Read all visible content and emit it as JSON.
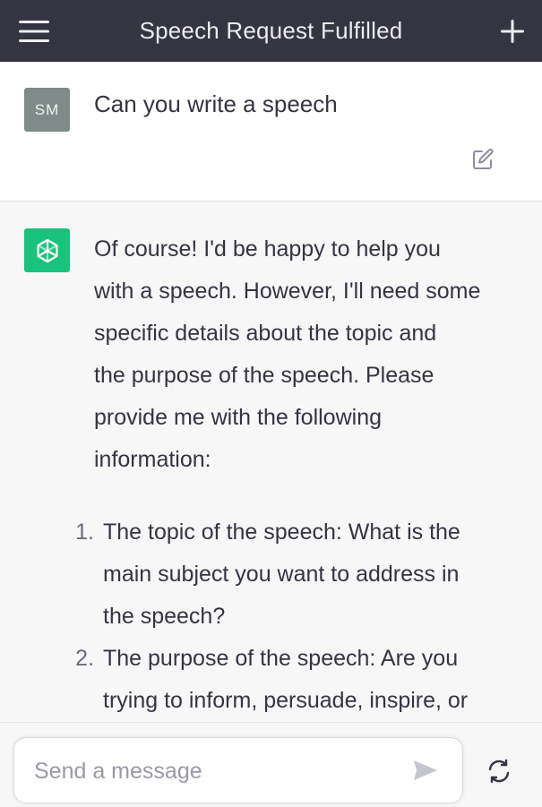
{
  "header": {
    "title": "Speech Request Fulfilled",
    "menu_icon": "hamburger-menu-icon",
    "new_chat_icon": "plus-icon"
  },
  "user_message": {
    "avatar_initials": "SM",
    "text": "Can you write a speech",
    "edit_icon": "edit-icon"
  },
  "assistant_message": {
    "avatar_icon": "openai-logo-icon",
    "intro_lines": [
      "Of course! I'd be happy to help you",
      "with a speech. However, I'll need some",
      "specific details about the topic and",
      "the purpose of the speech. Please",
      "provide me with the following",
      "information:"
    ],
    "list": [
      {
        "number": "1.",
        "lines": [
          "The topic of the speech: What is the",
          "main subject you want to address in",
          "the speech?"
        ]
      },
      {
        "number": "2.",
        "lines": [
          "The purpose of the speech: Are you",
          "trying to inform, persuade, inspire, or"
        ]
      }
    ]
  },
  "composer": {
    "placeholder": "Send a message",
    "send_icon": "send-icon",
    "regenerate_icon": "regenerate-icon"
  },
  "colors": {
    "header_bg": "#343541",
    "assistant_avatar": "#19c37d",
    "user_avatar": "#7e8b88",
    "page_bg": "#f7f7f8"
  }
}
